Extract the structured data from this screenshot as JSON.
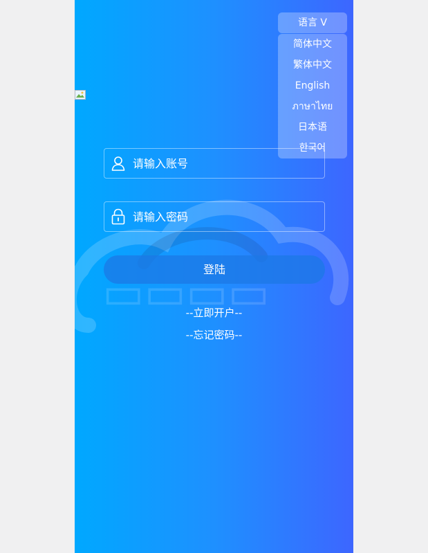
{
  "language": {
    "toggle_label": "语言 V",
    "options": [
      "简体中文",
      "繁体中文",
      "English",
      "ภาษาไทย",
      "日本语",
      "한국어"
    ]
  },
  "login": {
    "account_placeholder": "请输入账号",
    "password_placeholder": "请输入密码",
    "submit_label": "登陆",
    "register_link": "--立即开户--",
    "forgot_link": "--忘记密码--"
  },
  "colors": {
    "gradient_start": "#00a8ff",
    "gradient_end": "#3d66ff"
  },
  "icons": {
    "account": "user-icon",
    "password": "lock-icon"
  }
}
